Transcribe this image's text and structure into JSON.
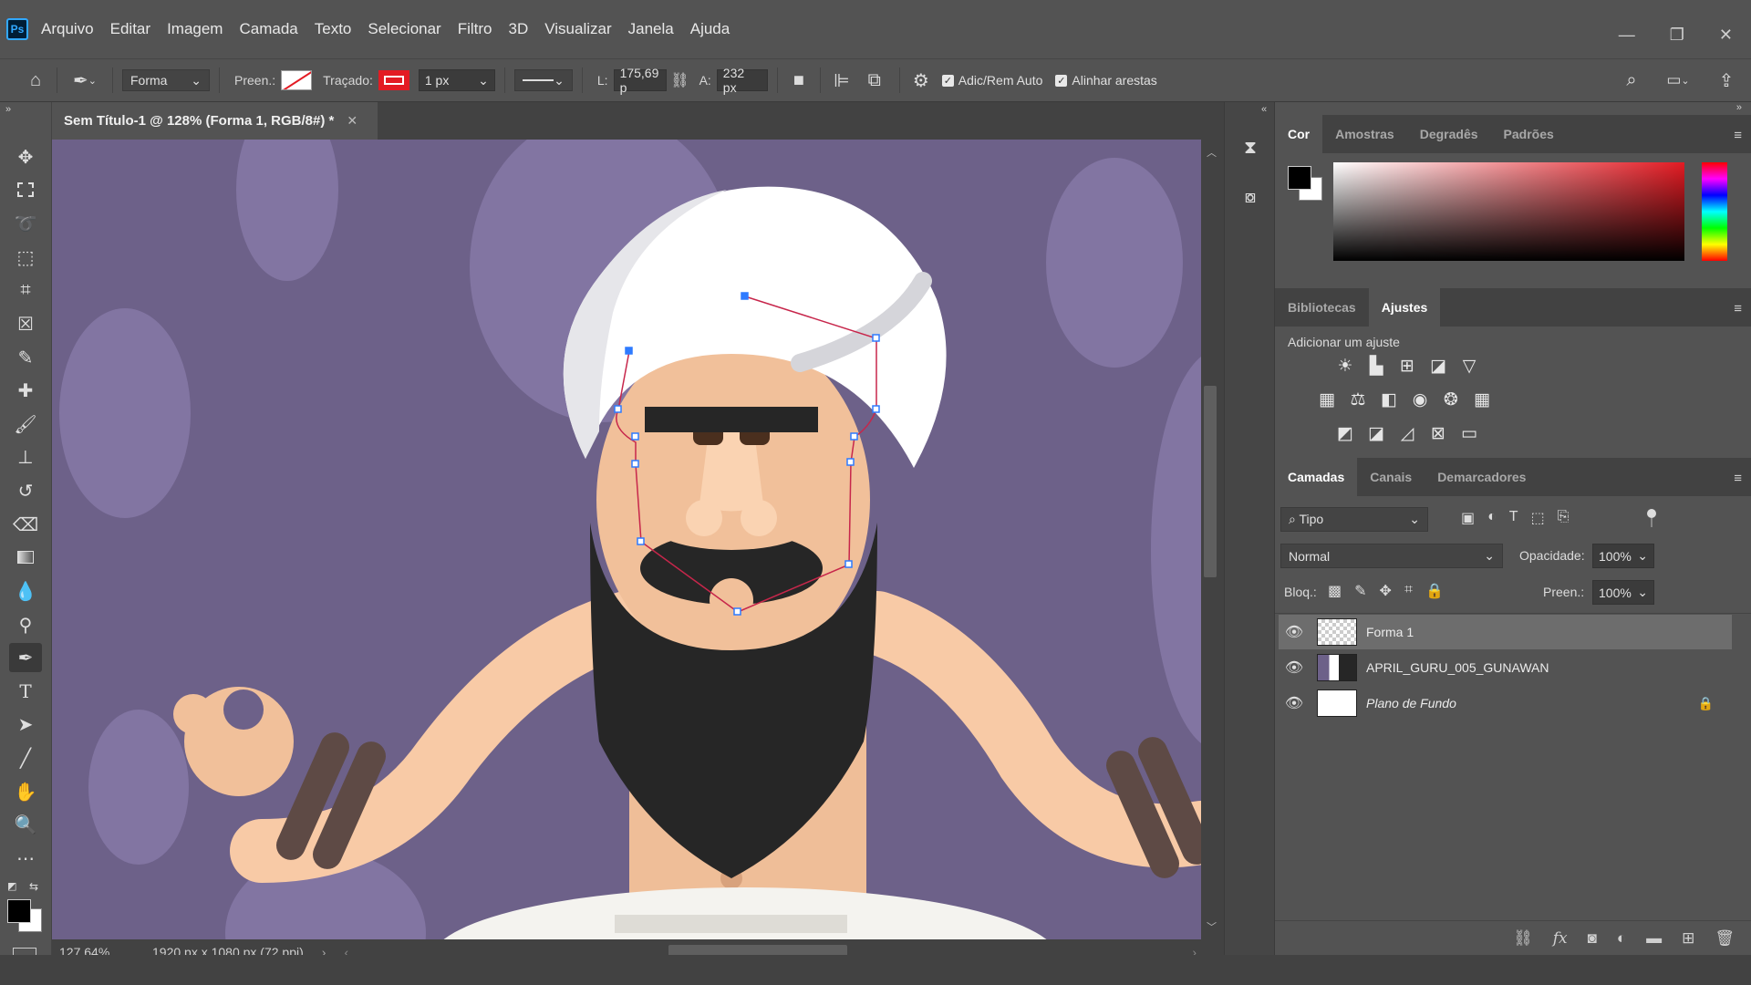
{
  "app": {
    "logo": "Ps",
    "menu": [
      "Arquivo",
      "Editar",
      "Imagem",
      "Camada",
      "Texto",
      "Selecionar",
      "Filtro",
      "3D",
      "Visualizar",
      "Janela",
      "Ajuda"
    ],
    "window_controls": [
      "minimize-icon",
      "restore-icon",
      "close-icon"
    ]
  },
  "options_bar": {
    "mode": "Forma",
    "fill_label": "Preen.:",
    "stroke_label": "Traçado:",
    "stroke_color": "#e31b23",
    "stroke_width": "1 px",
    "width_label": "L:",
    "width_value": "175,69 p",
    "height_label": "A:",
    "height_value": "232 px",
    "auto_add_delete": "Adic/Rem Auto",
    "align_edges": "Alinhar arestas"
  },
  "document": {
    "tab_title": "Sem Título-1 @ 128% (Forma 1, RGB/8#) *",
    "zoom": "127,64%",
    "doc_info": "1920 px x 1080 px (72 ppi)",
    "canvas_bg": "#6d6189"
  },
  "color_panel": {
    "tabs": [
      "Cor",
      "Amostras",
      "Degradês",
      "Padrões"
    ],
    "active_tab": "Cor",
    "foreground": "#000000",
    "background": "#ffffff"
  },
  "adjust_panel": {
    "tabs": [
      "Bibliotecas",
      "Ajustes"
    ],
    "active_tab": "Ajustes",
    "heading": "Adicionar um ajuste"
  },
  "layers_panel": {
    "tabs": [
      "Camadas",
      "Canais",
      "Demarcadores"
    ],
    "active_tab": "Camadas",
    "filter_label": "Tipo",
    "blend_mode": "Normal",
    "opacity_label": "Opacidade:",
    "opacity_value": "100%",
    "lock_label": "Bloq.:",
    "fill_label": "Preen.:",
    "fill_value": "100%",
    "layers": [
      {
        "name": "Forma 1",
        "selected": true
      },
      {
        "name": "APRIL_GURU_005_GUNAWAN",
        "selected": false
      },
      {
        "name": "Plano de Fundo",
        "selected": false,
        "locked": true
      }
    ]
  },
  "colors": {
    "accent_blue": "#31a8ff",
    "path_stroke": "#e31b23",
    "skin": "#f1c09a",
    "beard": "#262626",
    "turban": "#ffffff"
  }
}
